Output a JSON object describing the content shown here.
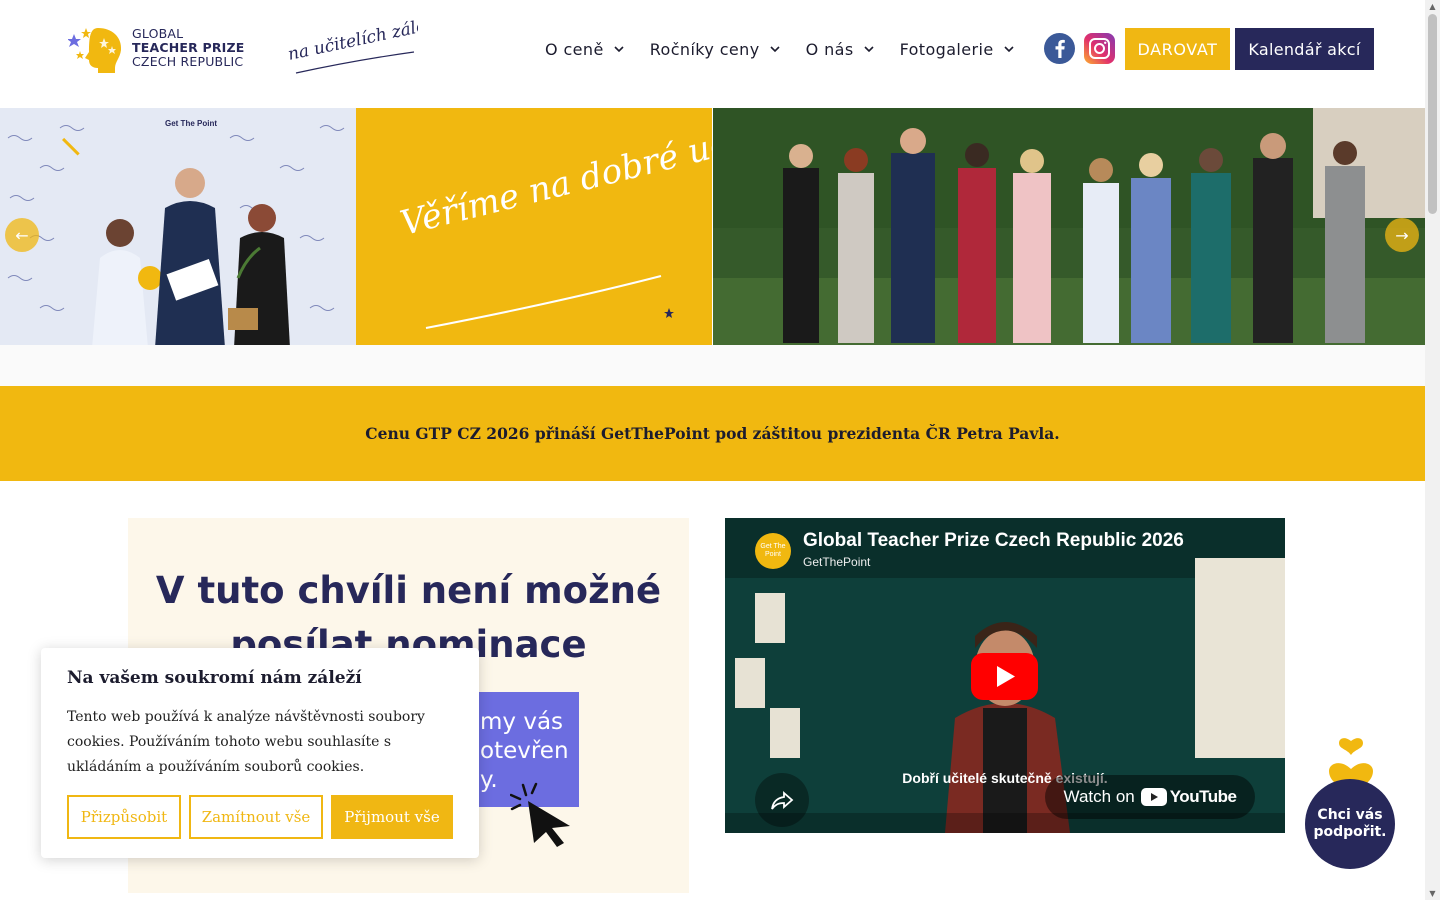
{
  "header": {
    "logo": {
      "line1": "GLOBAL",
      "line2": "TEACHER PRIZE",
      "line3": "CZECH REPUBLIC"
    },
    "slogan": "na učitelích záleží!",
    "nav": [
      {
        "label": "O ceně"
      },
      {
        "label": "Ročníky ceny"
      },
      {
        "label": "O nás"
      },
      {
        "label": "Fotogalerie"
      }
    ],
    "donate_label": "DAROVAT",
    "calendar_label": "Kalendář akcí"
  },
  "hero": {
    "slide2_text": "Věříme na dobré učitelky a učitele!",
    "slide1_badge": "Get The Point"
  },
  "banner": {
    "text": "Cenu GTP CZ 2026 přináší GetThePoint pod záštitou prezidenta ČR Petra Pavla."
  },
  "card": {
    "title": "V tuto chvíli není možné posílat nominace",
    "box_text_line1": "my vás",
    "box_text_line2": "otevřen",
    "box_text_line3": "y."
  },
  "video": {
    "title": "Global Teacher Prize Czech Republic 2026",
    "channel": "GetThePoint",
    "avatar_text": "Get The Point",
    "subtitle": "Dobří učitelé skutečně existují.",
    "watch_on": "Watch on",
    "youtube": "YouTube"
  },
  "cookie": {
    "title": "Na vašem soukromí nám záleží",
    "text": "Tento web používá k analýze návštěvnosti soubory cookies. Používáním tohoto webu souhlasíte s ukládáním a používáním souborů cookies.",
    "customize": "Přizpůsobit",
    "reject": "Zamítnout vše",
    "accept": "Přijmout vše"
  },
  "support": {
    "line1": "Chci vás",
    "line2": "podpořit."
  },
  "colors": {
    "accent_yellow": "#f0b713",
    "navy": "#27285a",
    "purple": "#6c6de0"
  }
}
